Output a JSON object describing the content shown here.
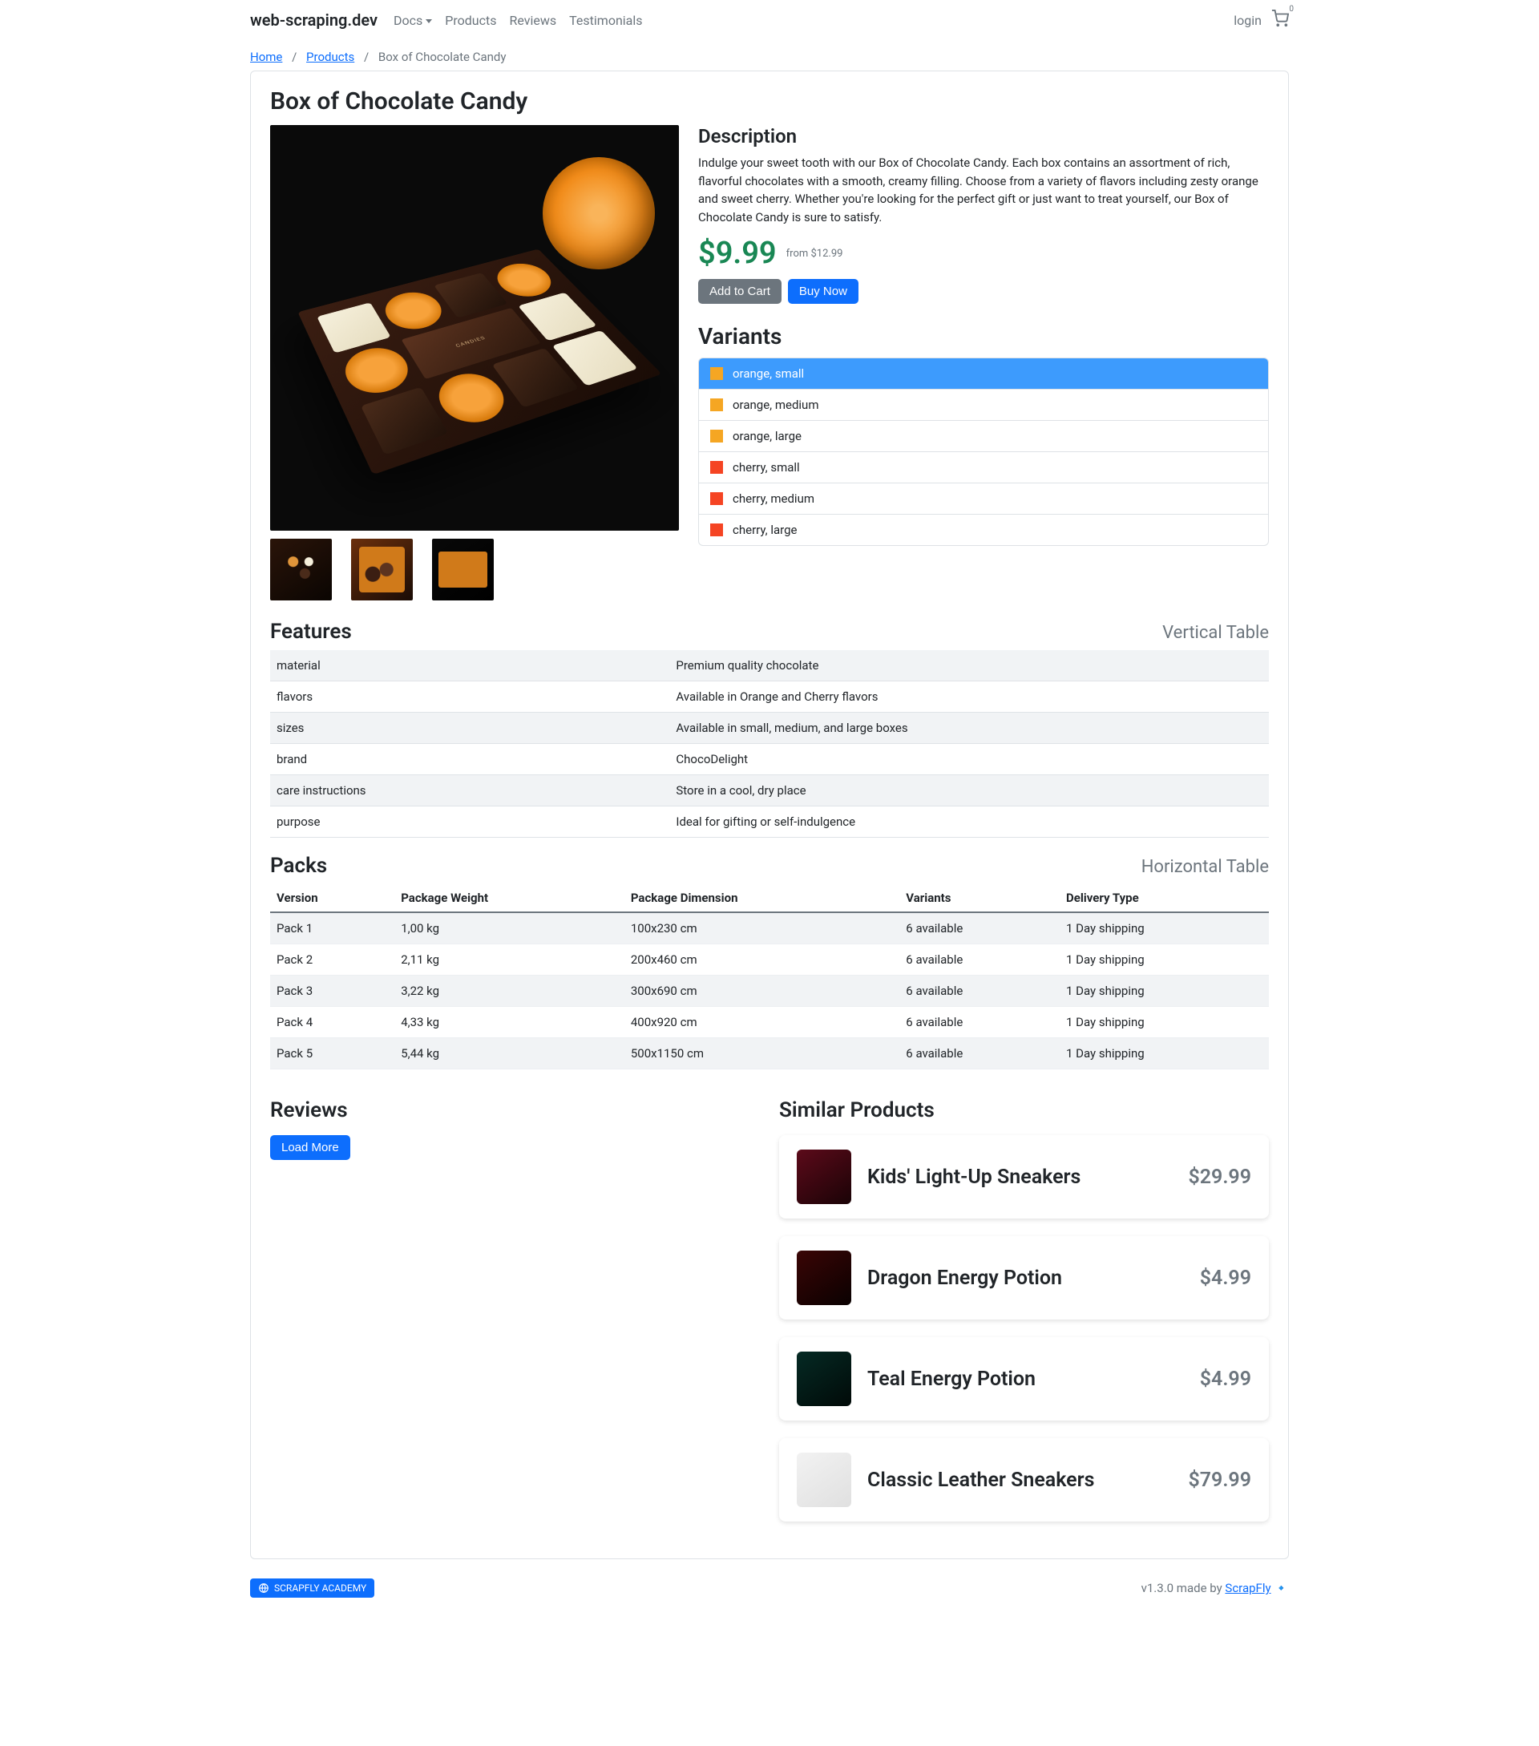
{
  "brand": "web-scraping.dev",
  "nav": {
    "docs": "Docs",
    "products": "Products",
    "reviews": "Reviews",
    "testimonials": "Testimonials",
    "login": "login",
    "cartCount": "0"
  },
  "breadcrumb": {
    "home": "Home",
    "products": "Products",
    "current": "Box of Chocolate Candy"
  },
  "product": {
    "title": "Box of Chocolate Candy",
    "descHeading": "Description",
    "description": "Indulge your sweet tooth with our Box of Chocolate Candy. Each box contains an assortment of rich, flavorful chocolates with a smooth, creamy filling. Choose from a variety of flavors including zesty orange and sweet cherry. Whether you're looking for the perfect gift or just want to treat yourself, our Box of Chocolate Candy is sure to satisfy.",
    "price": "$9.99",
    "oldPrice": "from $12.99",
    "addToCart": "Add to Cart",
    "buyNow": "Buy Now",
    "variantsHeading": "Variants",
    "variants": [
      {
        "color": "orange",
        "label": "orange, small",
        "active": true
      },
      {
        "color": "orange",
        "label": "orange, medium",
        "active": false
      },
      {
        "color": "orange",
        "label": "orange, large",
        "active": false
      },
      {
        "color": "cherry",
        "label": "cherry, small",
        "active": false
      },
      {
        "color": "cherry",
        "label": "cherry, medium",
        "active": false
      },
      {
        "color": "cherry",
        "label": "cherry, large",
        "active": false
      }
    ]
  },
  "features": {
    "heading": "Features",
    "hint": "Vertical Table",
    "rows": [
      {
        "k": "material",
        "v": "Premium quality chocolate"
      },
      {
        "k": "flavors",
        "v": "Available in Orange and Cherry flavors"
      },
      {
        "k": "sizes",
        "v": "Available in small, medium, and large boxes"
      },
      {
        "k": "brand",
        "v": "ChocoDelight"
      },
      {
        "k": "care instructions",
        "v": "Store in a cool, dry place"
      },
      {
        "k": "purpose",
        "v": "Ideal for gifting or self-indulgence"
      }
    ]
  },
  "packs": {
    "heading": "Packs",
    "hint": "Horizontal Table",
    "headers": [
      "Version",
      "Package Weight",
      "Package Dimension",
      "Variants",
      "Delivery Type"
    ],
    "rows": [
      [
        "Pack 1",
        "1,00 kg",
        "100x230 cm",
        "6 available",
        "1 Day shipping"
      ],
      [
        "Pack 2",
        "2,11 kg",
        "200x460 cm",
        "6 available",
        "1 Day shipping"
      ],
      [
        "Pack 3",
        "3,22 kg",
        "300x690 cm",
        "6 available",
        "1 Day shipping"
      ],
      [
        "Pack 4",
        "4,33 kg",
        "400x920 cm",
        "6 available",
        "1 Day shipping"
      ],
      [
        "Pack 5",
        "5,44 kg",
        "500x1150 cm",
        "6 available",
        "1 Day shipping"
      ]
    ]
  },
  "reviews": {
    "heading": "Reviews",
    "loadMore": "Load More"
  },
  "similar": {
    "heading": "Similar Products",
    "items": [
      {
        "title": "Kids' Light-Up Sneakers",
        "price": "$29.99",
        "thumbBg": "linear-gradient(145deg,#5c0a1a,#1a0306)"
      },
      {
        "title": "Dragon Energy Potion",
        "price": "$4.99",
        "thumbBg": "linear-gradient(145deg,#3a0505,#0a0101)"
      },
      {
        "title": "Teal Energy Potion",
        "price": "$4.99",
        "thumbBg": "linear-gradient(145deg,#052a24,#010a08)"
      },
      {
        "title": "Classic Leather Sneakers",
        "price": "$79.99",
        "thumbBg": "linear-gradient(145deg,#f2f2f2,#e0e0e0)"
      }
    ]
  },
  "footer": {
    "academy": "SCRAPFLY ACADEMY",
    "version": "v1.3.0 made by ",
    "link": "ScrapFly",
    "emoji": "🔹"
  }
}
